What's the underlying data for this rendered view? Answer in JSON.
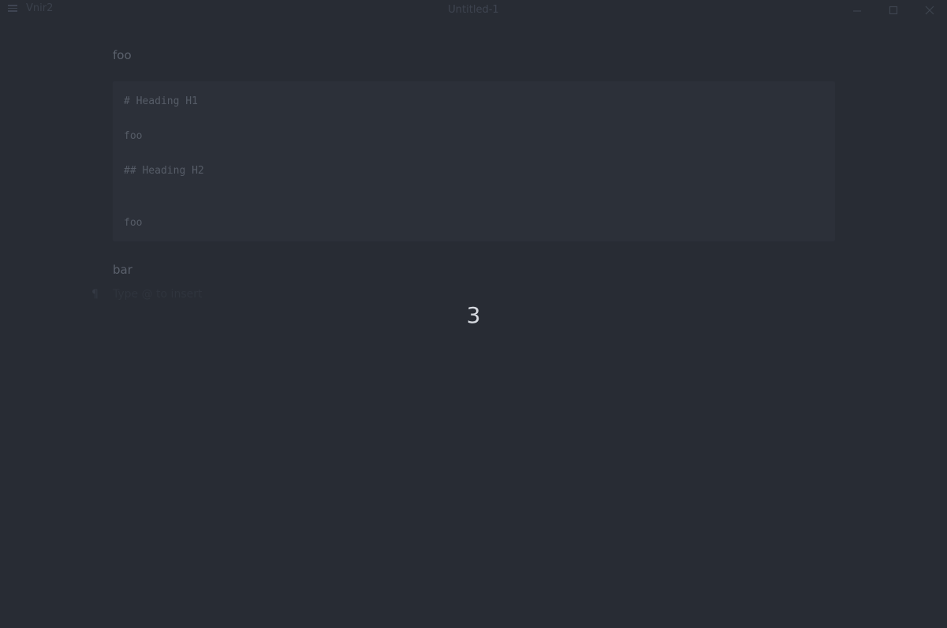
{
  "app": {
    "name": "Vnir2",
    "window_title": "Untitled-1"
  },
  "titlebar": {
    "menu_icon": "hamburger-menu-icon",
    "controls": {
      "minimize_icon": "minimize-icon",
      "maximize_icon": "maximize-icon",
      "close_icon": "close-icon"
    }
  },
  "editor": {
    "paragraph_1": "foo",
    "code_block": {
      "lines": [
        "# Heading H1",
        "foo",
        "## Heading H2",
        "foo"
      ]
    },
    "paragraph_2": "bar",
    "new_block_icon": "pilcrow-icon",
    "placeholder": "Type @ to insert"
  },
  "overlay": {
    "countdown": "3"
  },
  "colors": {
    "background": "#282c34",
    "code_background": "#2c3039",
    "countdown_text": "#d7dae0"
  }
}
